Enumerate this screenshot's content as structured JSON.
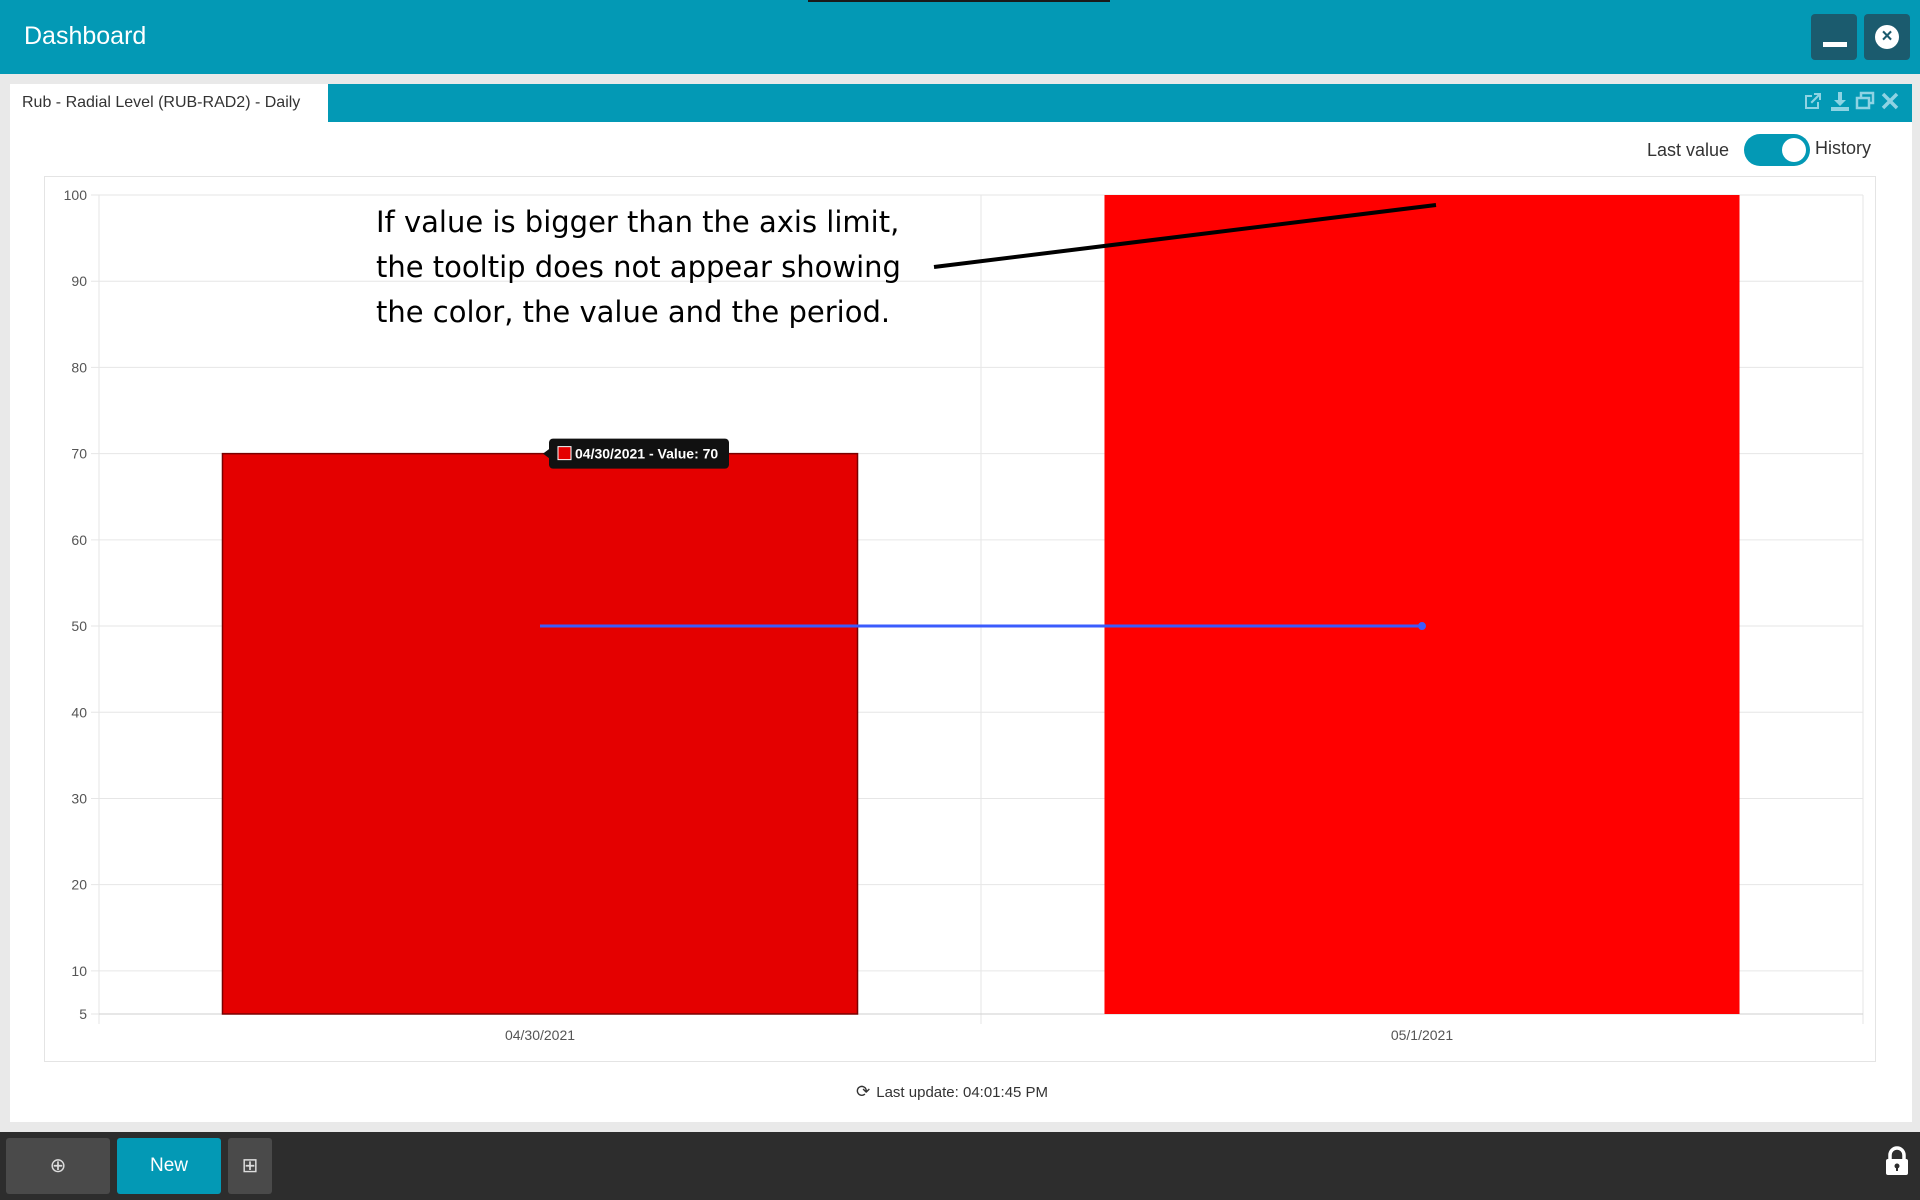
{
  "app": {
    "title": "Dashboard"
  },
  "widget": {
    "tab_label": "Rub - Radial Level (RUB-RAD2) - Daily",
    "tools": [
      "external-link-icon",
      "download-icon",
      "restore-window-icon",
      "close-icon"
    ],
    "toggle": {
      "left_label": "Last value",
      "right_label": "History",
      "state": "History"
    },
    "last_update": "Last update: 04:01:45 PM"
  },
  "annotation": {
    "lines": [
      "If value is bigger than the axis limit,",
      "the tooltip does not appear showing",
      "the color, the value and the period."
    ]
  },
  "tooltip": {
    "text": "04/30/2021 - Value: 70",
    "swatch_color": "#e40000"
  },
  "chart_data": {
    "type": "bar",
    "categories": [
      "04/30/2021",
      "05/1/2021"
    ],
    "values": [
      70,
      100
    ],
    "bar_colors": [
      "#e40000",
      "#ff0000"
    ],
    "threshold_line": {
      "value": 50,
      "color": "#3b5bfd"
    },
    "ylim": [
      5,
      100
    ],
    "yticks": [
      5,
      10,
      20,
      30,
      40,
      50,
      60,
      70,
      80,
      90,
      100
    ],
    "grid": true
  },
  "bottombar": {
    "new_label": "New",
    "add_icon": "plus-circle-icon",
    "plus_icon": "plus-square-icon",
    "lock_icon": "lock-icon"
  }
}
